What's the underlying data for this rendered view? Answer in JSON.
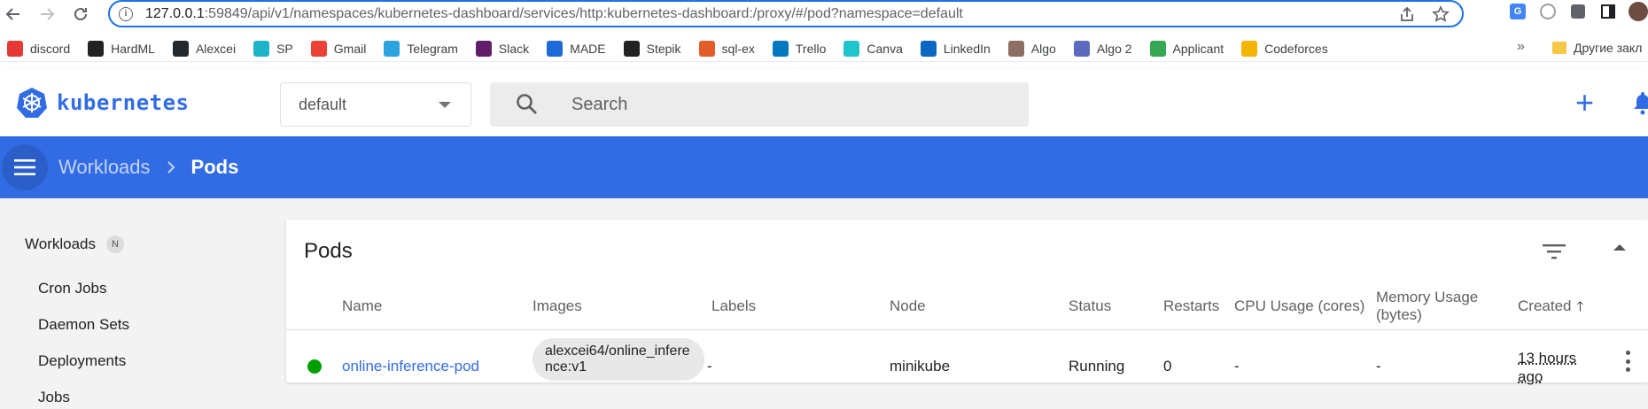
{
  "browser": {
    "url_host": "127.0.0.1",
    "url_rest": ":59849/api/v1/namespaces/kubernetes-dashboard/services/http:kubernetes-dashboard:/proxy/#/pod?namespace=default"
  },
  "bookmarks": [
    {
      "label": "discord",
      "icon": "discord-icon",
      "color": "#e53935"
    },
    {
      "label": "HardML",
      "icon": "hardml-icon",
      "color": "#222222"
    },
    {
      "label": "Alexcei",
      "icon": "github-icon",
      "color": "#24292e"
    },
    {
      "label": "SP",
      "icon": "sp-icon",
      "color": "#1db4c9"
    },
    {
      "label": "Gmail",
      "icon": "gmail-icon",
      "color": "#ea4335"
    },
    {
      "label": "Telegram",
      "icon": "telegram-icon",
      "color": "#2aa3df"
    },
    {
      "label": "Slack",
      "icon": "slack-icon",
      "color": "#611f69"
    },
    {
      "label": "MADE",
      "icon": "made-icon",
      "color": "#1e6ad8"
    },
    {
      "label": "Stepik",
      "icon": "stepik-icon",
      "color": "#222222"
    },
    {
      "label": "sql-ex",
      "icon": "sqlex-icon",
      "color": "#e35d2b"
    },
    {
      "label": "Trello",
      "icon": "trello-icon",
      "color": "#0079bf"
    },
    {
      "label": "Canva",
      "icon": "canva-icon",
      "color": "#20c4cb"
    },
    {
      "label": "LinkedIn",
      "icon": "linkedin-icon",
      "color": "#0a66c2"
    },
    {
      "label": "Algo",
      "icon": "algo-icon",
      "color": "#8d6e63"
    },
    {
      "label": "Algo 2",
      "icon": "algo2-icon",
      "color": "#5c6bc0"
    },
    {
      "label": "Applicant",
      "icon": "applicant-icon",
      "color": "#34a853"
    },
    {
      "label": "Codeforces",
      "icon": "codeforces-icon",
      "color": "#f4b400"
    }
  ],
  "bookmarks_more": "»",
  "bookmarks_other": "Другие закл",
  "app": {
    "logo_text": "kubernetes",
    "namespace": "default",
    "search_placeholder": "Search",
    "accent": "#326ce5"
  },
  "breadcrumb": {
    "parent": "Workloads",
    "current": "Pods"
  },
  "sidebar": {
    "section": "Workloads",
    "section_badge": "N",
    "items": [
      "Cron Jobs",
      "Daemon Sets",
      "Deployments",
      "Jobs"
    ]
  },
  "pods_card": {
    "title": "Pods",
    "columns": {
      "name": "Name",
      "images": "Images",
      "labels": "Labels",
      "node": "Node",
      "status": "Status",
      "restarts": "Restarts",
      "cpu": "CPU Usage (cores)",
      "memory": "Memory Usage (bytes)",
      "created": "Created"
    },
    "rows": [
      {
        "status_color": "#00a000",
        "name": "online-inference-pod",
        "image": "alexcei64/online_inference:v1",
        "labels": "-",
        "node": "minikube",
        "status": "Running",
        "restarts": "0",
        "cpu": "-",
        "memory": "-",
        "created": "13 hours ago"
      }
    ]
  }
}
